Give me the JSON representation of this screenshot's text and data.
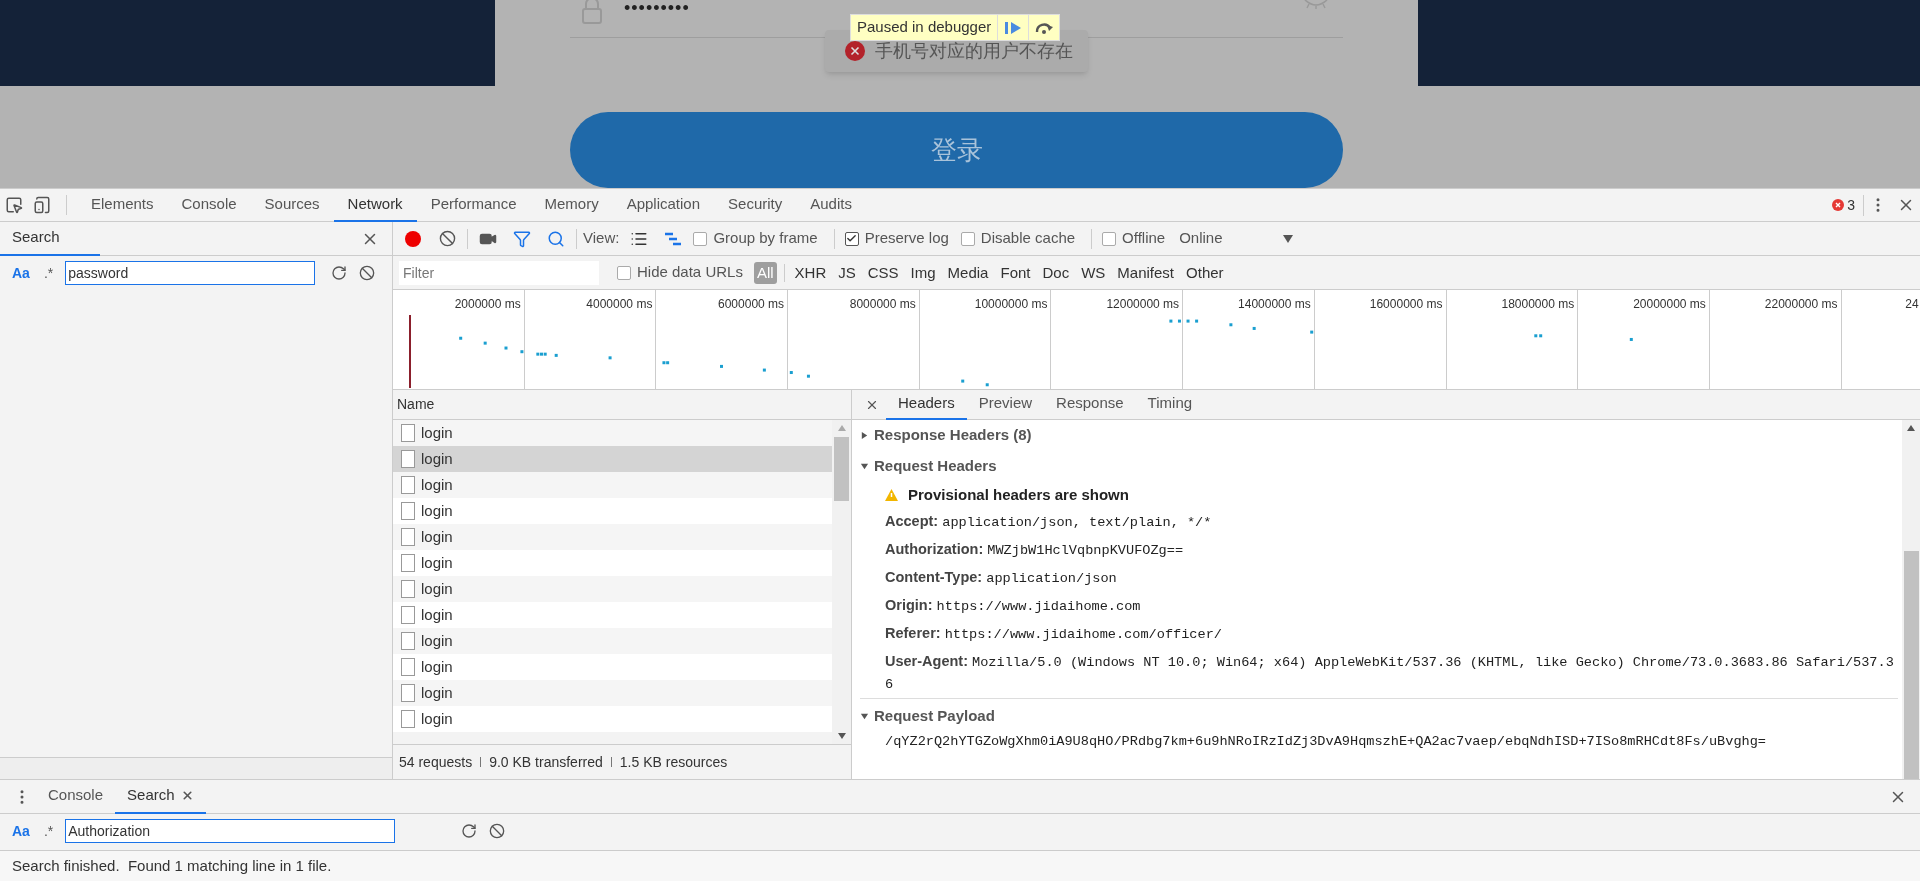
{
  "page": {
    "password_dots": "•••••••••",
    "toast": "手机号对应的用户不存在",
    "debugger_banner": "Paused in debugger",
    "login_button": "登录"
  },
  "devtools": {
    "tabs": [
      {
        "label": "Elements",
        "selected": false
      },
      {
        "label": "Console",
        "selected": false
      },
      {
        "label": "Sources",
        "selected": false
      },
      {
        "label": "Network",
        "selected": true
      },
      {
        "label": "Performance",
        "selected": false
      },
      {
        "label": "Memory",
        "selected": false
      },
      {
        "label": "Application",
        "selected": false
      },
      {
        "label": "Security",
        "selected": false
      },
      {
        "label": "Audits",
        "selected": false
      }
    ],
    "error_count": "3"
  },
  "search_pane": {
    "title": "Search",
    "match_case": "Aa",
    "regex": ".*",
    "query": "password"
  },
  "network_toolbar": {
    "recording": true,
    "view_label": "View:",
    "options": [
      {
        "label": "Group by frame",
        "checked": false
      },
      {
        "label": "Preserve log",
        "checked": true
      },
      {
        "label": "Disable cache",
        "checked": false
      },
      {
        "label": "Offline",
        "checked": false
      }
    ],
    "throttle": "Online"
  },
  "filter_bar": {
    "placeholder": "Filter",
    "hide_data_urls": {
      "label": "Hide data URLs",
      "checked": false
    },
    "types": [
      {
        "label": "All",
        "selected": true
      },
      {
        "label": "XHR",
        "selected": false
      },
      {
        "label": "JS",
        "selected": false
      },
      {
        "label": "CSS",
        "selected": false
      },
      {
        "label": "Img",
        "selected": false
      },
      {
        "label": "Media",
        "selected": false
      },
      {
        "label": "Font",
        "selected": false
      },
      {
        "label": "Doc",
        "selected": false
      },
      {
        "label": "WS",
        "selected": false
      },
      {
        "label": "Manifest",
        "selected": false
      },
      {
        "label": "Other",
        "selected": false
      }
    ]
  },
  "timeline": {
    "ticks": [
      "2000000 ms",
      "4000000 ms",
      "6000000 ms",
      "8000000 ms",
      "10000000 ms",
      "12000000 ms",
      "14000000 ms",
      "16000000 ms",
      "18000000 ms",
      "20000000 ms",
      "22000000 ms",
      "24"
    ]
  },
  "requests": {
    "column": "Name",
    "rows": [
      {
        "name": "login",
        "selected": false
      },
      {
        "name": "login",
        "selected": true
      },
      {
        "name": "login",
        "selected": false
      },
      {
        "name": "login",
        "selected": false
      },
      {
        "name": "login",
        "selected": false
      },
      {
        "name": "login",
        "selected": false
      },
      {
        "name": "login",
        "selected": false
      },
      {
        "name": "login",
        "selected": false
      },
      {
        "name": "login",
        "selected": false
      },
      {
        "name": "login",
        "selected": false
      },
      {
        "name": "login",
        "selected": false
      },
      {
        "name": "login",
        "selected": false
      }
    ],
    "summary": [
      "54 requests",
      "9.0 KB transferred",
      "1.5 KB resources"
    ]
  },
  "details": {
    "tabs": [
      {
        "label": "Headers",
        "selected": true
      },
      {
        "label": "Preview",
        "selected": false
      },
      {
        "label": "Response",
        "selected": false
      },
      {
        "label": "Timing",
        "selected": false
      }
    ],
    "sections": [
      {
        "title": "Response Headers (8)",
        "expanded": false
      },
      {
        "title": "Request Headers",
        "expanded": true,
        "warning": "Provisional headers are shown",
        "headers": [
          {
            "name": "Accept:",
            "value": "application/json, text/plain, */*"
          },
          {
            "name": "Authorization:",
            "value": "MWZjbW1HclVqbnpKVUFOZg=="
          },
          {
            "name": "Content-Type:",
            "value": "application/json"
          },
          {
            "name": "Origin:",
            "value": "https://www.jidaihome.com"
          },
          {
            "name": "Referer:",
            "value": "https://www.jidaihome.com/officer/"
          },
          {
            "name": "User-Agent:",
            "value": "Mozilla/5.0 (Windows NT 10.0; Win64; x64) AppleWebKit/537.36 (KHTML, like Gecko) Chrome/73.0.3683.86 Safari/537.36"
          }
        ]
      },
      {
        "title": "Request Payload",
        "expanded": true,
        "payload": "/qYZ2rQ2hYTGZoWgXhm0iA9U8qHO/PRdbg7km+6u9hNRoIRzIdZj3DvA9HqmszhE+QA2ac7vaep/ebqNdhISD+7ISo8mRHCdt8Fs/uBvghg="
      }
    ]
  },
  "drawer": {
    "tabs": [
      {
        "label": "Console",
        "selected": false,
        "closable": false
      },
      {
        "label": "Search",
        "selected": true,
        "closable": true
      }
    ],
    "match_case": "Aa",
    "regex": ".*",
    "query": "Authorization",
    "status": "Search finished.  Found 1 matching line in 1 file."
  }
}
